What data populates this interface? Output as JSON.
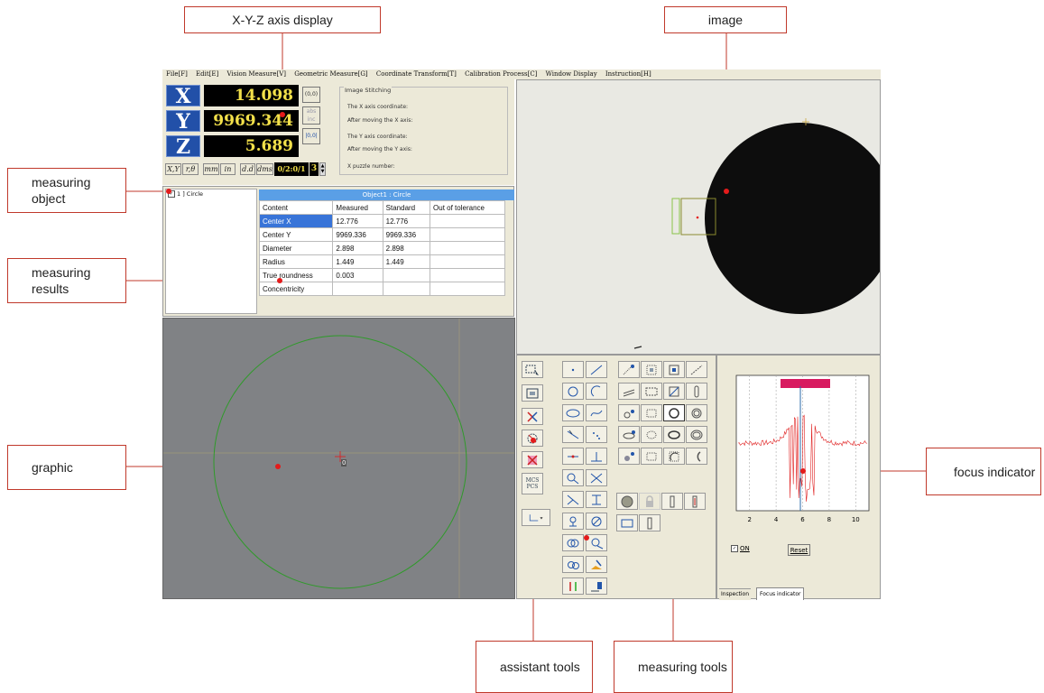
{
  "callouts": {
    "axis_display": "X-Y-Z axis display",
    "image": "image",
    "measuring_object": "measuring object",
    "measuring_results": "measuring results",
    "graphic": "graphic",
    "focus_indicator": "focus indicator",
    "assistant_tools": "assistant tools",
    "measuring_tools": "measuring tools"
  },
  "menu": [
    "File[F]",
    "Edit[E]",
    "Vision Measure[V]",
    "Geometric Measure[G]",
    "Coordinate Transform[T]",
    "Calibration Process[C]",
    "Window Display",
    "Instruction[H]"
  ],
  "dro": {
    "x_label": "X",
    "y_label": "Y",
    "z_label": "Z",
    "x_value": "14.098",
    "y_value": "9969.344",
    "z_value": "5.689",
    "origin_btn": "(0,0)",
    "abs_btn": "abs inc",
    "mode_xy": "X,Y",
    "mode_rt": "r,θ",
    "unit_mm": "mm",
    "unit_in": "in",
    "fmt_dd": "d.d",
    "fmt_dms": "dms",
    "counter": "0/2:0/1",
    "spin_value": "3"
  },
  "stitching": {
    "title": "Image Stitching",
    "x_coord": "The X axis coordinate:",
    "after_x": "After moving the X axis:",
    "y_coord": "The Y axis coordinate:",
    "after_y": "After moving the Y axis:",
    "puzzle": "X puzzle number:"
  },
  "object_list": {
    "item": "1 ] Circle"
  },
  "results": {
    "title": "Object1 : Circle",
    "headers": [
      "Content",
      "Measured",
      "Standard",
      "Out of tolerance"
    ],
    "rows": [
      [
        "Center X",
        "12.776",
        "12.776",
        ""
      ],
      [
        "Center Y",
        "9969.336",
        "9969.336",
        ""
      ],
      [
        "Diameter",
        "2.898",
        "2.898",
        ""
      ],
      [
        "Radius",
        "1.449",
        "1.449",
        ""
      ],
      [
        "True roundness",
        "0.003",
        "",
        ""
      ],
      [
        "Concentricity",
        "",
        "",
        ""
      ]
    ]
  },
  "graphic": {
    "label": "0"
  },
  "assistant": {
    "mcs": "MCS",
    "pcs": "PCS"
  },
  "focus": {
    "x_ticks": [
      "2",
      "4",
      "6",
      "8",
      "10"
    ],
    "on_label": "ON",
    "reset_btn": "Reset",
    "tab_inspection": "Inspection",
    "tab_focus": "Focus indicator"
  },
  "colors": {
    "callout_border": "#c0392b",
    "dro_key": "#2250a8",
    "dro_digits": "#f2e04a",
    "graphic_bg": "#808285",
    "graphic_circle": "#2f9a2a",
    "results_header": "#5a9fe6",
    "focus_curve": "#e02020"
  }
}
